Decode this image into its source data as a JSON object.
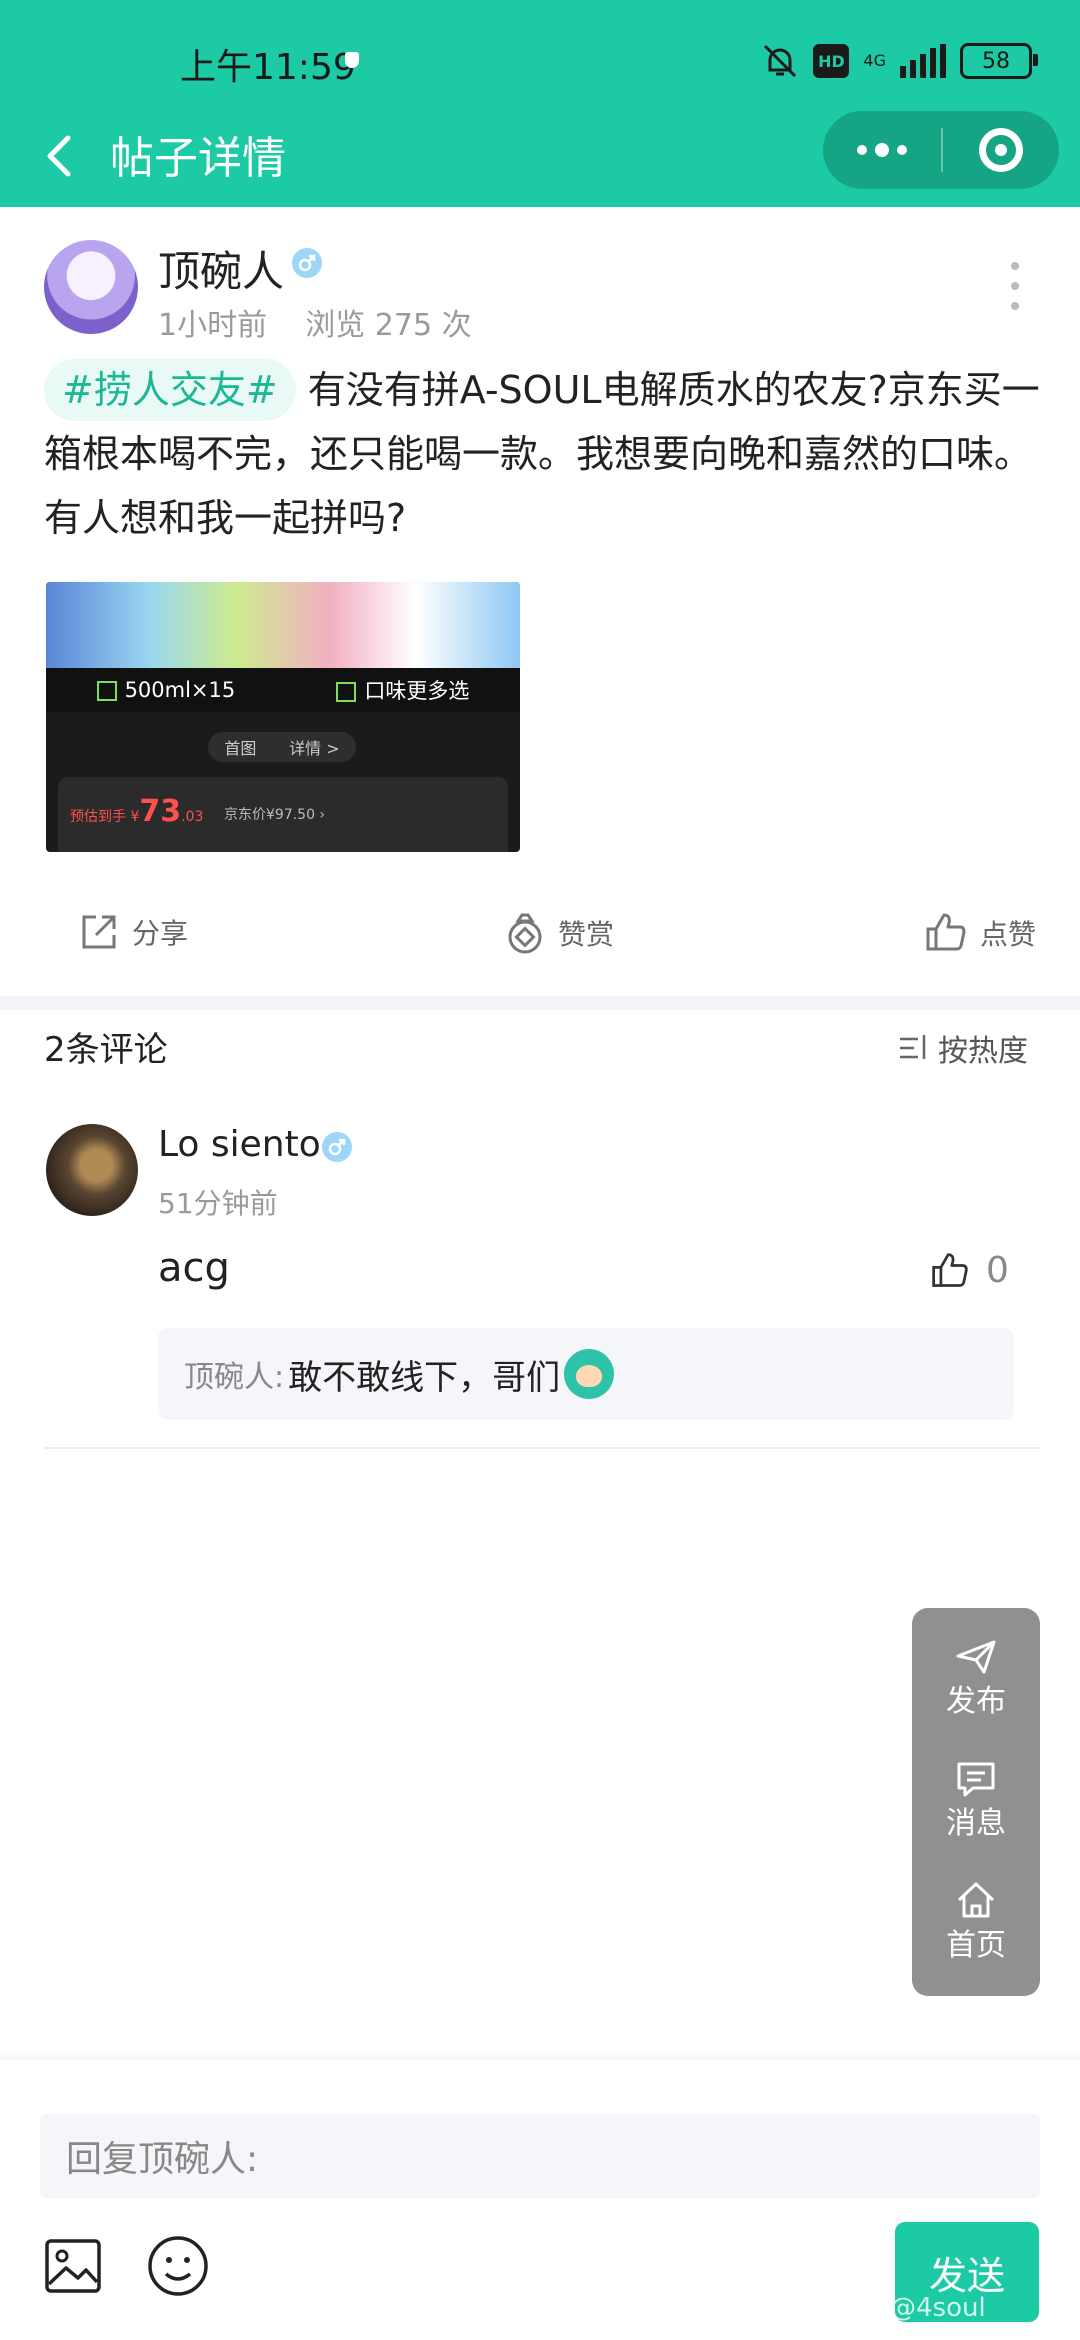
{
  "status": {
    "time": "上午11:59",
    "network": "4G",
    "battery": "58"
  },
  "nav": {
    "title": "帖子详情"
  },
  "post": {
    "author": "顶碗人",
    "time": "1小时前",
    "views": "浏览 275 次",
    "tag": "#捞人交友#",
    "text": "有没有拼A-SOUL电解质水的农友?京东买一箱根本喝不完，还只能喝一款。我想要向晚和嘉然的口味。有人想和我一起拼吗?",
    "image": {
      "label1": "500ml×15",
      "label2": "口味更多选",
      "tab1": "首图",
      "tab2": "详情 >",
      "price_prefix": "预估到手 ¥",
      "price": "73",
      "price_cents": ".03",
      "orig": "京东价¥97.50 ›"
    }
  },
  "actions": {
    "share": "分享",
    "reward": "赞赏",
    "like": "点赞"
  },
  "comments": {
    "header": "2条评论",
    "sort": "按热度",
    "items": [
      {
        "name": "Lo siento",
        "time": "51分钟前",
        "text": "acg",
        "likes": "0",
        "reply": {
          "name": "顶碗人:",
          "text": "敢不敢线下，哥们"
        }
      }
    ]
  },
  "float_menu": {
    "publish": "发布",
    "messages": "消息",
    "home": "首页"
  },
  "composer": {
    "placeholder": "回复顶碗人:",
    "send": "发送",
    "watermark": "@4soul"
  },
  "colors": {
    "accent": "#1ccaa5"
  }
}
